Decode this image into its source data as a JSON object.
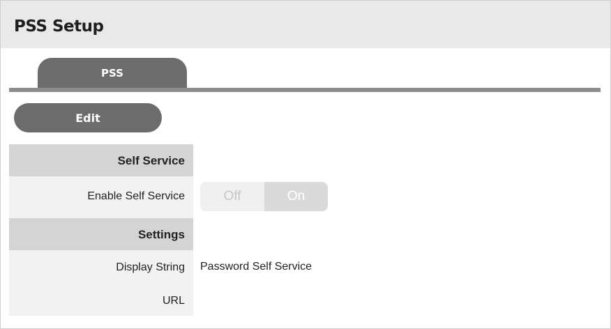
{
  "page": {
    "title": "PSS Setup"
  },
  "tabs": [
    {
      "label": "PSS"
    }
  ],
  "toolbar": {
    "edit_label": "Edit"
  },
  "sections": {
    "self_service": {
      "heading": "Self Service",
      "enable_label": "Enable Self Service",
      "toggle": {
        "off_label": "Off",
        "on_label": "On",
        "selected": "On"
      }
    },
    "settings": {
      "heading": "Settings",
      "display_string_label": "Display String",
      "display_string_value": "Password Self Service",
      "url_label": "URL",
      "url_value": ""
    }
  },
  "colors": {
    "tab": "#6c6c6c",
    "title_bar": "#e9e9e9",
    "section_header": "#d4d4d4",
    "label_column": "#f2f2f2"
  }
}
